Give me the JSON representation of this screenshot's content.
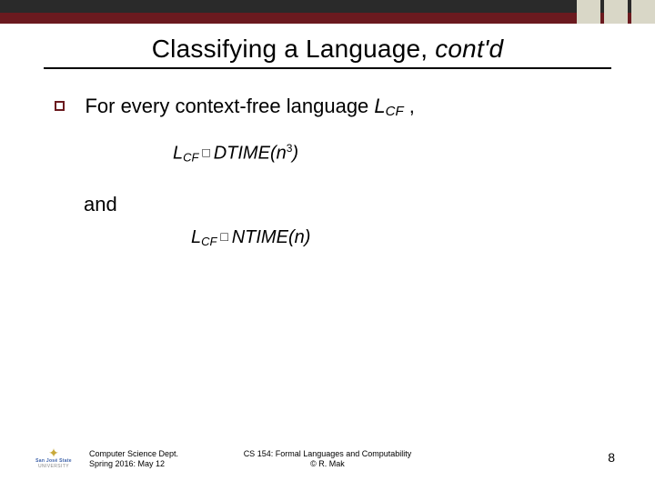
{
  "title": {
    "main": "Classifying a Language, ",
    "italic": "cont'd"
  },
  "bullet": {
    "prefix": "For every context-free language ",
    "lang_sym": "L",
    "lang_sub": "CF",
    "suffix": " ,"
  },
  "formula1": {
    "lhs_sym": "L",
    "lhs_sub": "CF",
    "rel": " □ ",
    "cls": "DTIME",
    "arg_open": "(",
    "arg_var": "n",
    "arg_sup": "3",
    "arg_close": ")"
  },
  "and": "and",
  "formula2": {
    "lhs_sym": "L",
    "lhs_sub": "CF",
    "rel": " □ ",
    "cls": "NTIME",
    "arg_open": "(",
    "arg_var": "n",
    "arg_close": ")"
  },
  "footer": {
    "left_line1": "Computer Science Dept.",
    "left_line2": "Spring 2016: May 12",
    "center_line1": "CS 154: Formal Languages and Computability",
    "center_line2": "© R. Mak",
    "page": "8",
    "logo_name": "San José State",
    "logo_sub": "UNIVERSITY"
  }
}
